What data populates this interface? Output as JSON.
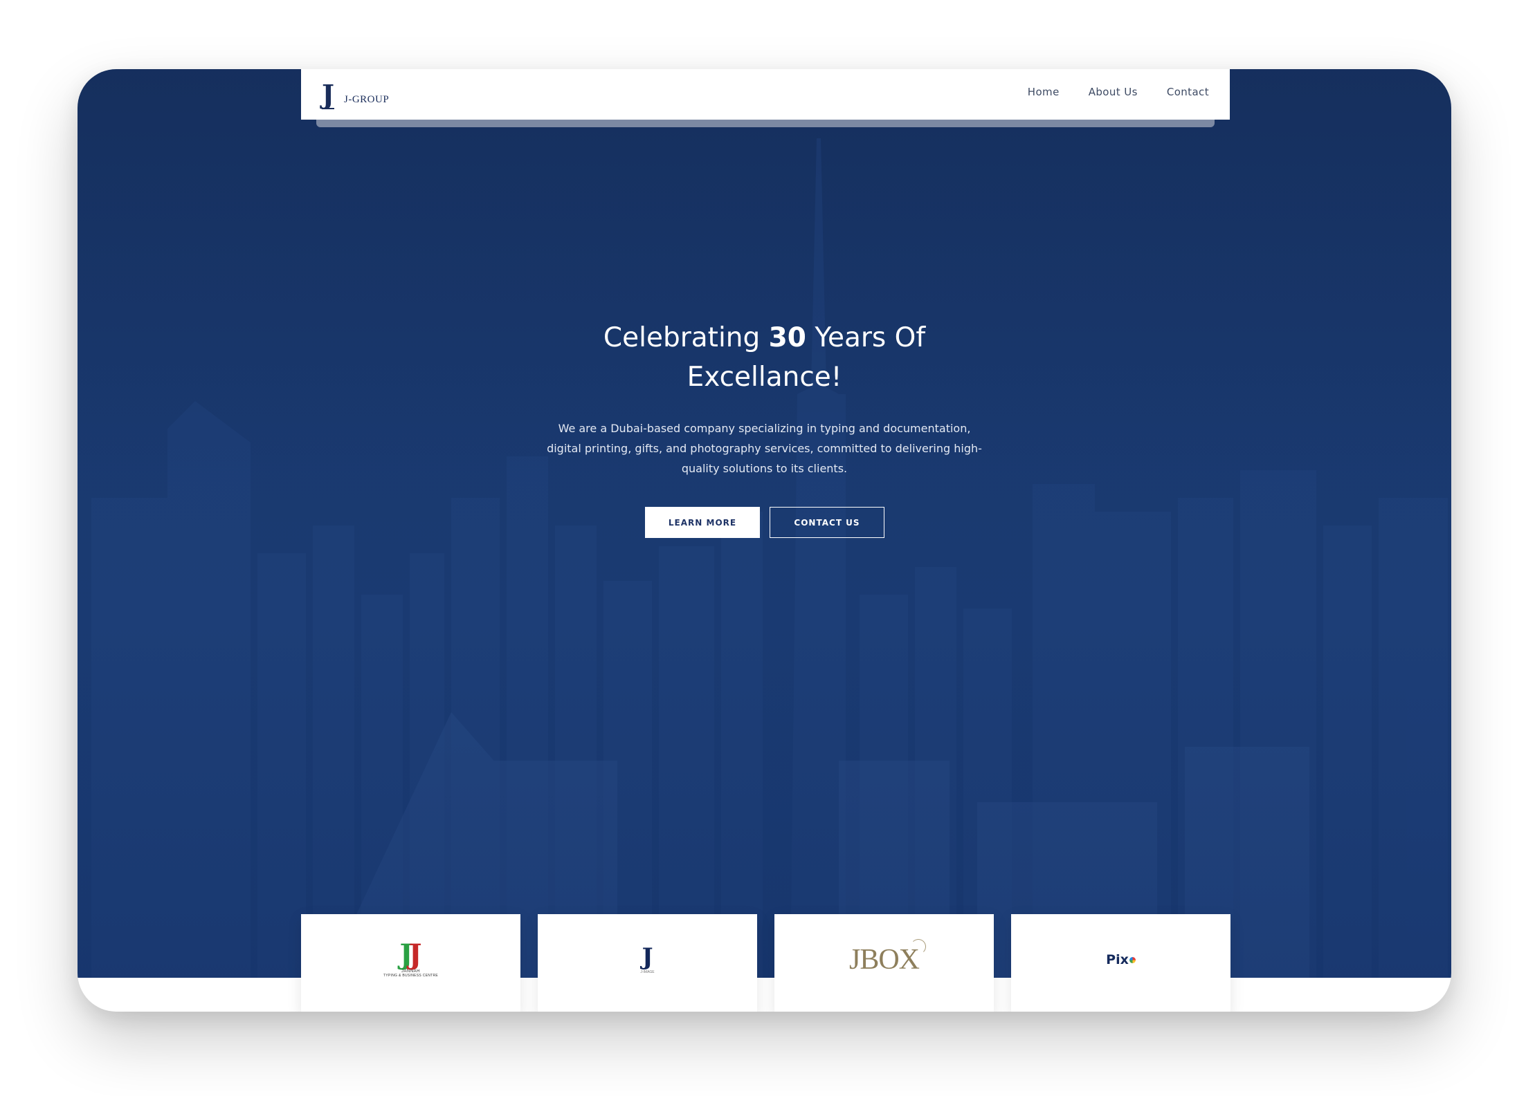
{
  "header": {
    "logo_mark": "J",
    "logo_text": "J-GROUP",
    "nav": [
      {
        "label": "Home"
      },
      {
        "label": "About Us"
      },
      {
        "label": "Contact"
      }
    ]
  },
  "hero": {
    "title_prefix": "Celebrating ",
    "title_bold": "30",
    "title_suffix": " Years Of",
    "title_line2": "Excellance!",
    "description": "We are a Dubai-based company specializing in typing and documentation, digital printing, gifts, and photography services, committed to delivering high-quality solutions to its clients.",
    "learn_more_label": "LEARN MORE",
    "contact_us_label": "CONTACT US"
  },
  "brands": [
    {
      "name": "JANNAH",
      "subtitle": "TYPING & BUSINESS CENTRE",
      "colors": [
        "#2aa043",
        "#c62828"
      ]
    },
    {
      "name": "J",
      "subtitle": "J-IMAGE"
    },
    {
      "name": "JBOX",
      "color": "#8e7f5c"
    },
    {
      "name": "Pix",
      "color": "#152a5c"
    }
  ],
  "colors": {
    "hero_bg": "#1a3a71",
    "navy": "#1a2d5a",
    "white": "#ffffff"
  }
}
